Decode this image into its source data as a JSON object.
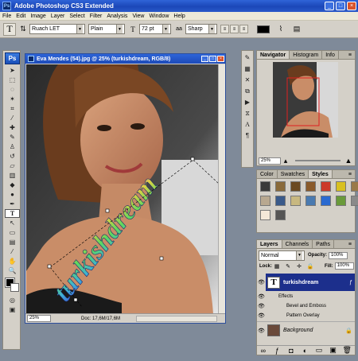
{
  "app": {
    "title": "Adobe Photoshop CS3 Extended",
    "logo": "Ps"
  },
  "menu": [
    "File",
    "Edit",
    "Image",
    "Layer",
    "Select",
    "Filter",
    "Analysis",
    "View",
    "Window",
    "Help"
  ],
  "options": {
    "font_family": "Ruach LET",
    "font_style": "Plain",
    "font_size": "72 pt",
    "antialias_prefix": "aa",
    "antialias": "Sharp",
    "text_color": "#000000"
  },
  "document": {
    "title": "Eva Mendes (54).jpg @ 25% (turkishdream, RGB/8)",
    "zoom": "25%",
    "doc_size": "Doc: 17,6M/17,6M",
    "watermark": "turkishdream"
  },
  "navigator": {
    "tabs": [
      "Navigator",
      "Histogram",
      "Info"
    ],
    "zoom": "25%"
  },
  "swatches_panel": {
    "tabs": [
      "Color",
      "Swatches",
      "Styles"
    ],
    "styles": [
      "#3a3a3a",
      "#8a6a3a",
      "#6b4a22",
      "#8a5a2a",
      "#cc3a2a",
      "#d8c020",
      "#9a7a4a",
      "#b8a890",
      "#3a5a8a",
      "#c8b880",
      "#4a7ab0",
      "#2a6ad0",
      "#6a9a3a",
      "#8a8a8a",
      "#f4e8d8",
      "#555555"
    ]
  },
  "layers": {
    "tabs": [
      "Layers",
      "Channels",
      "Paths"
    ],
    "blend_mode": "Normal",
    "opacity_label": "Opacity:",
    "opacity": "100%",
    "lock_label": "Lock:",
    "fill_label": "Fill:",
    "fill": "100%",
    "text_layer": "turkishdream",
    "effects_label": "Effects",
    "effect_1": "Bevel and Emboss",
    "effect_2": "Pattern Overlay",
    "background": "Background"
  }
}
